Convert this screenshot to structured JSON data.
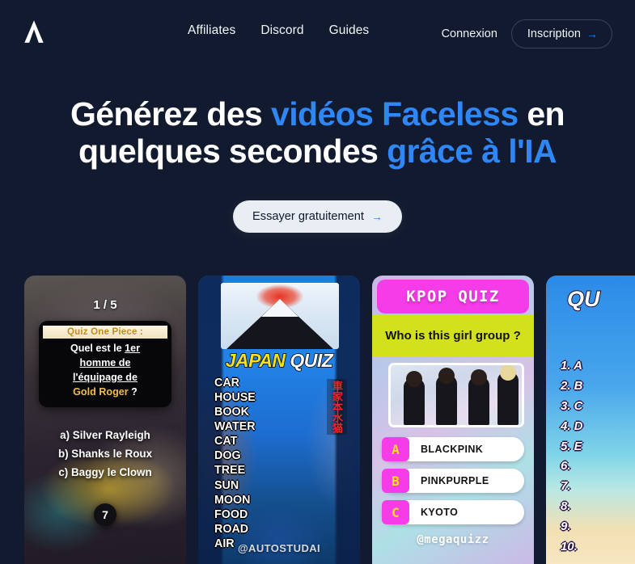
{
  "nav": {
    "logo_icon": "logo-a-icon",
    "links": [
      {
        "label": "Affiliates"
      },
      {
        "label": "Discord"
      },
      {
        "label": "Guides"
      }
    ],
    "login_label": "Connexion",
    "signup_label": "Inscription",
    "signup_arrow": "→"
  },
  "hero": {
    "line1_a": "Générez des ",
    "line1_b": "vidéos Faceless",
    "line1_c": " en",
    "line2_a": "quelques secondes ",
    "line2_b": "grâce à l'IA",
    "cta_label": "Essayer gratuitement",
    "cta_arrow": "→",
    "accent_color": "#2f86f5"
  },
  "cards": [
    {
      "id": "card-one-piece",
      "counter": "1 / 5",
      "banner": "Quiz One Piece :",
      "question_line1": "Quel est le ",
      "question_u1": "1er",
      "question_u2": "homme de",
      "question_u3": "l'équipage de",
      "question_gold": "Gold Roger",
      "question_tail": " ?",
      "answers": [
        "a) Silver Rayleigh",
        "b) Shanks le Roux",
        "c) Baggy le Clown"
      ],
      "timer": "7"
    },
    {
      "id": "card-japan-quiz",
      "title_a": "JAPAN ",
      "title_b": "QUIZ",
      "words": [
        "CAR",
        "HOUSE",
        "BOOK",
        "WATER",
        "CAT",
        "DOG",
        "TREE",
        "SUN",
        "MOON",
        "FOOD",
        "ROAD",
        "AIR"
      ],
      "kanji": "車家本水猫",
      "watermark": "@AUTOSTUDAI"
    },
    {
      "id": "card-kpop-quiz",
      "header": "KPOP QUIZ",
      "question": "Who is this girl group ?",
      "options": [
        {
          "letter": "A",
          "text": "BLACKPINK"
        },
        {
          "letter": "B",
          "text": "PINKPURPLE"
        },
        {
          "letter": "C",
          "text": "KYOTO"
        }
      ],
      "watermark": "@megaquizz",
      "header_color": "#f53ce8",
      "band_color": "#d3e01c"
    },
    {
      "id": "card-quiz-partial",
      "title": "QU",
      "list": [
        "1. A",
        "2. B",
        "3. C",
        "4. D",
        "5. E",
        "6.",
        "7.",
        "8.",
        "9.",
        "10."
      ]
    }
  ]
}
